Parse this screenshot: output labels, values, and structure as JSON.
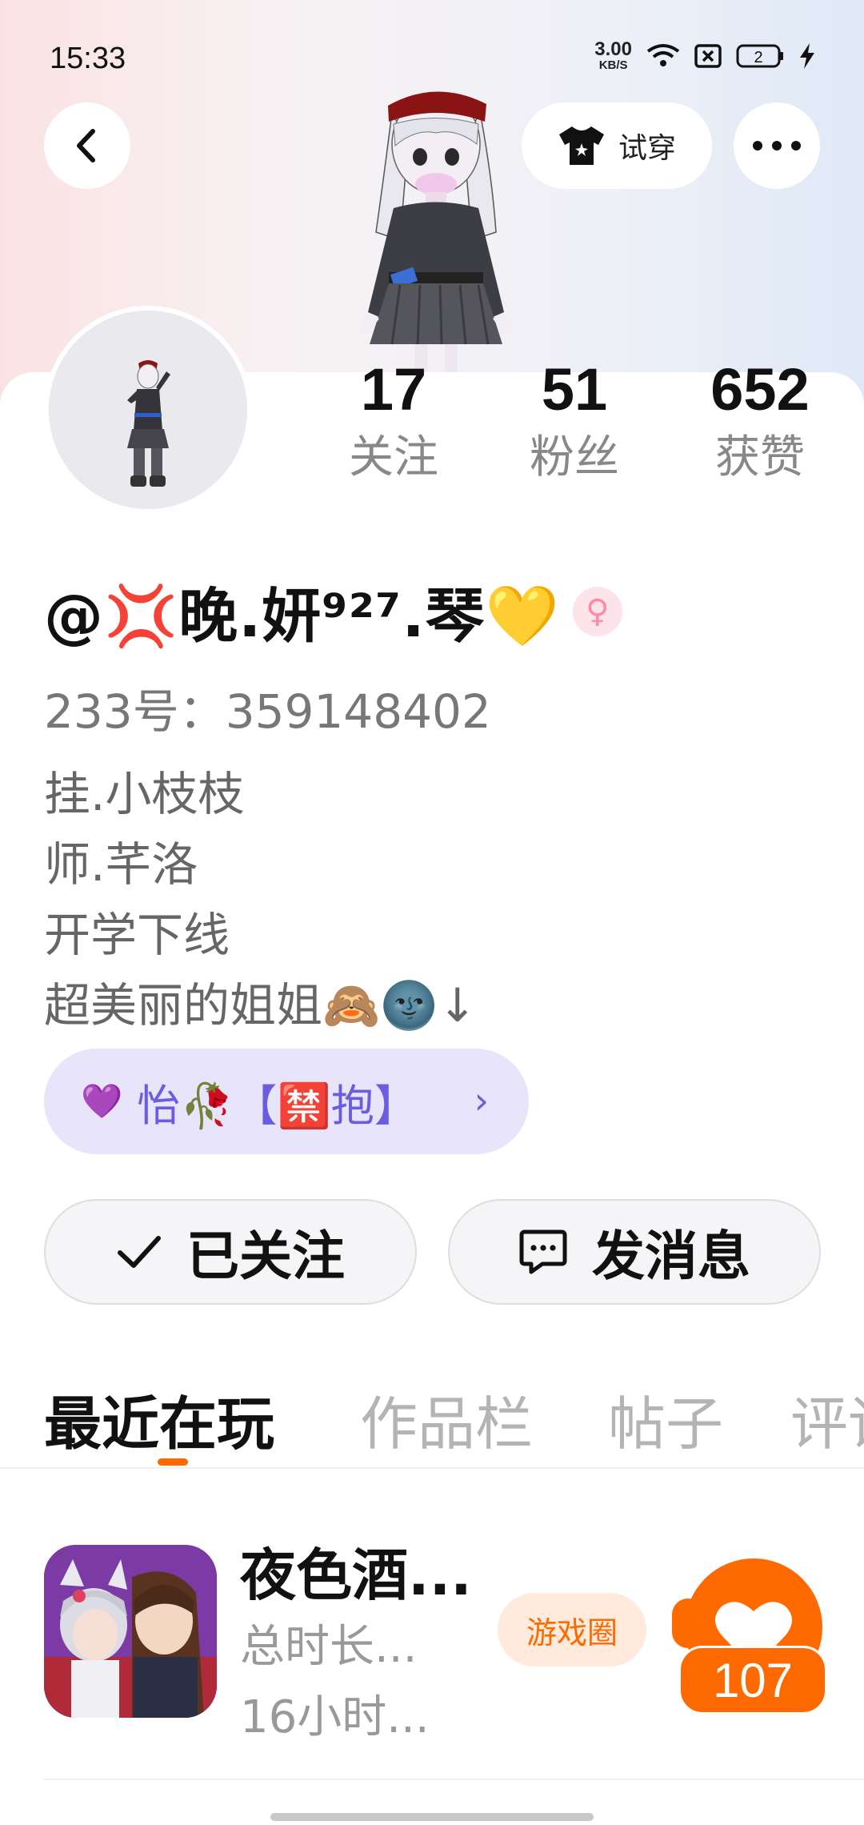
{
  "status_bar": {
    "time": "15:33",
    "net_speed_value": "3.00",
    "net_speed_unit": "KB/S",
    "battery_badge": "2"
  },
  "header": {
    "back_icon": "chevron-left-icon",
    "tryon_label": "试穿",
    "more_icon": "more-dots-icon"
  },
  "profile": {
    "nickname": "@💢晚.妍⁹²⁷.琴💛",
    "gender_symbol": "♀",
    "uid": "233号：359148402",
    "stats": [
      {
        "value": "17",
        "label": "关注"
      },
      {
        "value": "51",
        "label": "粉丝"
      },
      {
        "value": "652",
        "label": "获赞"
      }
    ],
    "bio": [
      "挂.小枝枝",
      "师.芊洛",
      "开学下线",
      "超美丽的姐姐🙈🌚↓"
    ]
  },
  "relation_chip": {
    "heart": "💜",
    "label": "怡🥀【🈲抱】",
    "arrow": "›"
  },
  "actions": {
    "follow_label": "已关注",
    "message_label": "发消息"
  },
  "tabs": [
    "最近在玩",
    "作品栏",
    "帖子",
    "评论"
  ],
  "recent_game": {
    "title": "夜色酒...",
    "meta_line1": "总时长...",
    "meta_line2": "16小时...",
    "circle_label": "游戏圈",
    "like_count": "107"
  },
  "colors": {
    "accent": "#ff6a00",
    "relation_bg": "#e8e5fb",
    "relation_fg": "#6b5ce0"
  }
}
